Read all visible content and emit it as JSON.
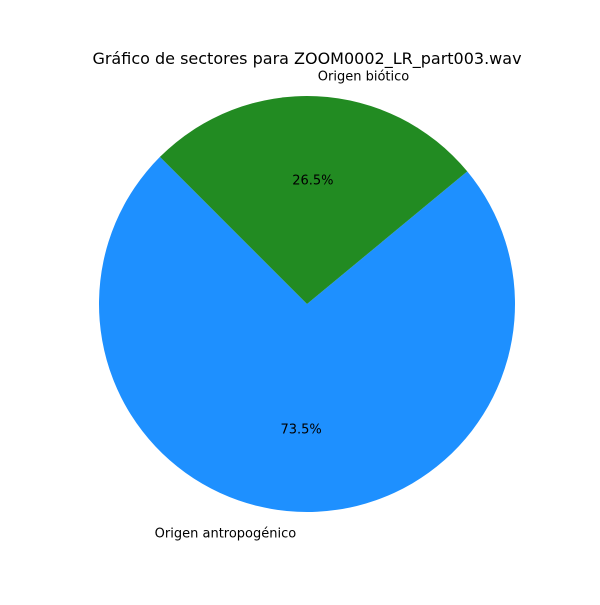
{
  "chart_data": {
    "type": "pie",
    "title": "Gráfico de sectores para ZOOM0002_LR_part003.wav",
    "slices": [
      {
        "label": "Origen antropogénico",
        "value": 73.5,
        "pct_label": "73.5%",
        "color": "#1e90ff"
      },
      {
        "label": "Origen biótico",
        "value": 26.5,
        "pct_label": "26.5%",
        "color": "#228b22"
      }
    ],
    "start_angle_deg": 135,
    "direction": "counterclockwise"
  }
}
